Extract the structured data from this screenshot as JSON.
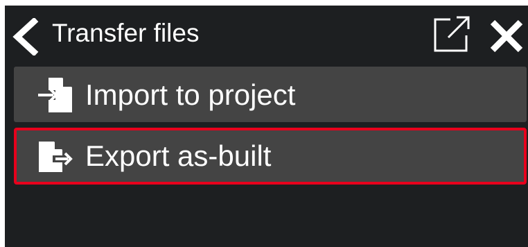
{
  "header": {
    "title": "Transfer files",
    "back_icon": "chevron-left-icon",
    "external_icon": "external-link-icon",
    "close_icon": "close-icon"
  },
  "menu": {
    "items": [
      {
        "label": "Import to project",
        "icon": "file-import-icon",
        "selected": false
      },
      {
        "label": "Export as-built",
        "icon": "file-export-icon",
        "selected": true
      }
    ]
  },
  "colors": {
    "background": "#1d1f21",
    "item_background": "#444444",
    "selection_border": "#e8001c",
    "text": "#ffffff"
  }
}
